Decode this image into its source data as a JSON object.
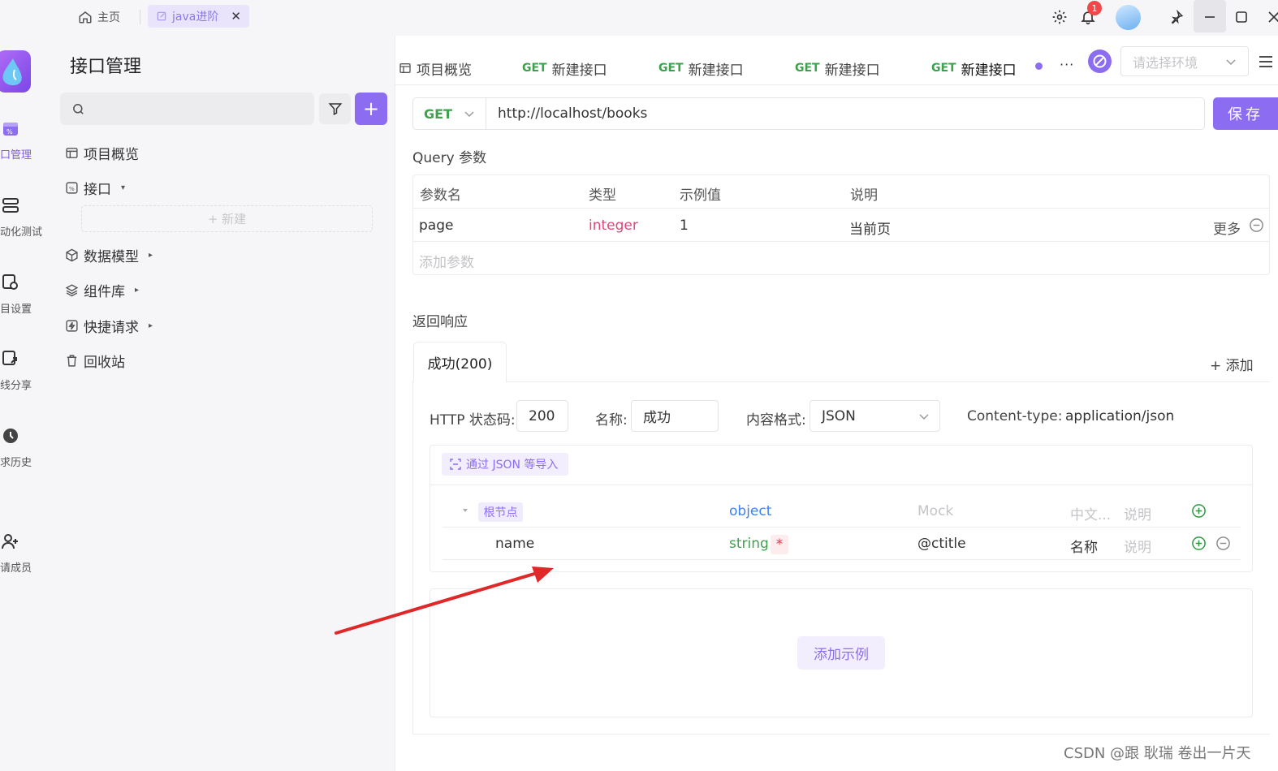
{
  "titlebar": {
    "home_tab": "主页",
    "project_tab": "java进阶",
    "close": "✕",
    "notification_count": "1"
  },
  "rail": {
    "items": [
      {
        "label": "口管理",
        "icon": "api-icon",
        "active": true
      },
      {
        "label": "动化测试",
        "icon": "test-icon"
      },
      {
        "label": "目设置",
        "icon": "settings-icon"
      },
      {
        "label": "线分享",
        "icon": "share-icon"
      },
      {
        "label": "求历史",
        "icon": "history-icon"
      },
      {
        "label": "请成员",
        "icon": "invite-icon"
      }
    ]
  },
  "panel": {
    "title": "接口管理",
    "search_placeholder": "",
    "add": "+",
    "tree": [
      {
        "label": "项目概览",
        "icon": "layout-icon"
      },
      {
        "label": "接口",
        "icon": "api-icon",
        "caret": "▾"
      },
      {
        "label": "数据模型",
        "icon": "cube-icon",
        "caret": "▸"
      },
      {
        "label": "组件库",
        "icon": "layers-icon",
        "caret": "▸"
      },
      {
        "label": "快捷请求",
        "icon": "bolt-icon",
        "caret": "▸"
      },
      {
        "label": "回收站",
        "icon": "trash-icon"
      }
    ],
    "new_label": "+ 新建"
  },
  "tabs": [
    {
      "label": "项目概览"
    },
    {
      "method": "GET",
      "label": "新建接口"
    },
    {
      "method": "GET",
      "label": "新建接口"
    },
    {
      "method": "GET",
      "label": "新建接口"
    },
    {
      "method": "GET",
      "label": "新建接口",
      "active": true
    }
  ],
  "more": "···",
  "env_placeholder": "请选择环境",
  "request": {
    "method": "GET",
    "url": "http://localhost/books",
    "save": "保存"
  },
  "query": {
    "title": "Query 参数",
    "headers": [
      "参数名",
      "类型",
      "示例值",
      "说明"
    ],
    "row": {
      "name": "page",
      "type": "integer",
      "example": "1",
      "desc": "当前页",
      "more": "更多"
    },
    "add_param": "添加参数"
  },
  "response": {
    "title": "返回响应",
    "tab": "成功(200)",
    "add": "+ 添加",
    "status_label": "HTTP 状态码:",
    "status_value": "200",
    "name_label": "名称:",
    "name_value": "成功",
    "format_label": "内容格式:",
    "format_value": "JSON",
    "content_type_label": "Content-type:",
    "content_type_value": "application/json",
    "import_label": "通过 JSON 等导入",
    "schema": {
      "root": {
        "name": "根节点",
        "type": "object",
        "mock": "Mock",
        "cn": "中文...",
        "desc": "说明"
      },
      "field": {
        "name": "name",
        "type": "string",
        "required": "*",
        "mock": "@ctitle",
        "cn": "名称",
        "desc": "说明"
      }
    },
    "add_example": "添加示例"
  },
  "watermark": "CSDN @跟 耿瑞 卷出一片天",
  "colors": {
    "accent": "#8c6cf0",
    "get": "#3fa14e",
    "integer": "#e0457b",
    "object": "#3b82f6",
    "string": "#3fa14e"
  }
}
